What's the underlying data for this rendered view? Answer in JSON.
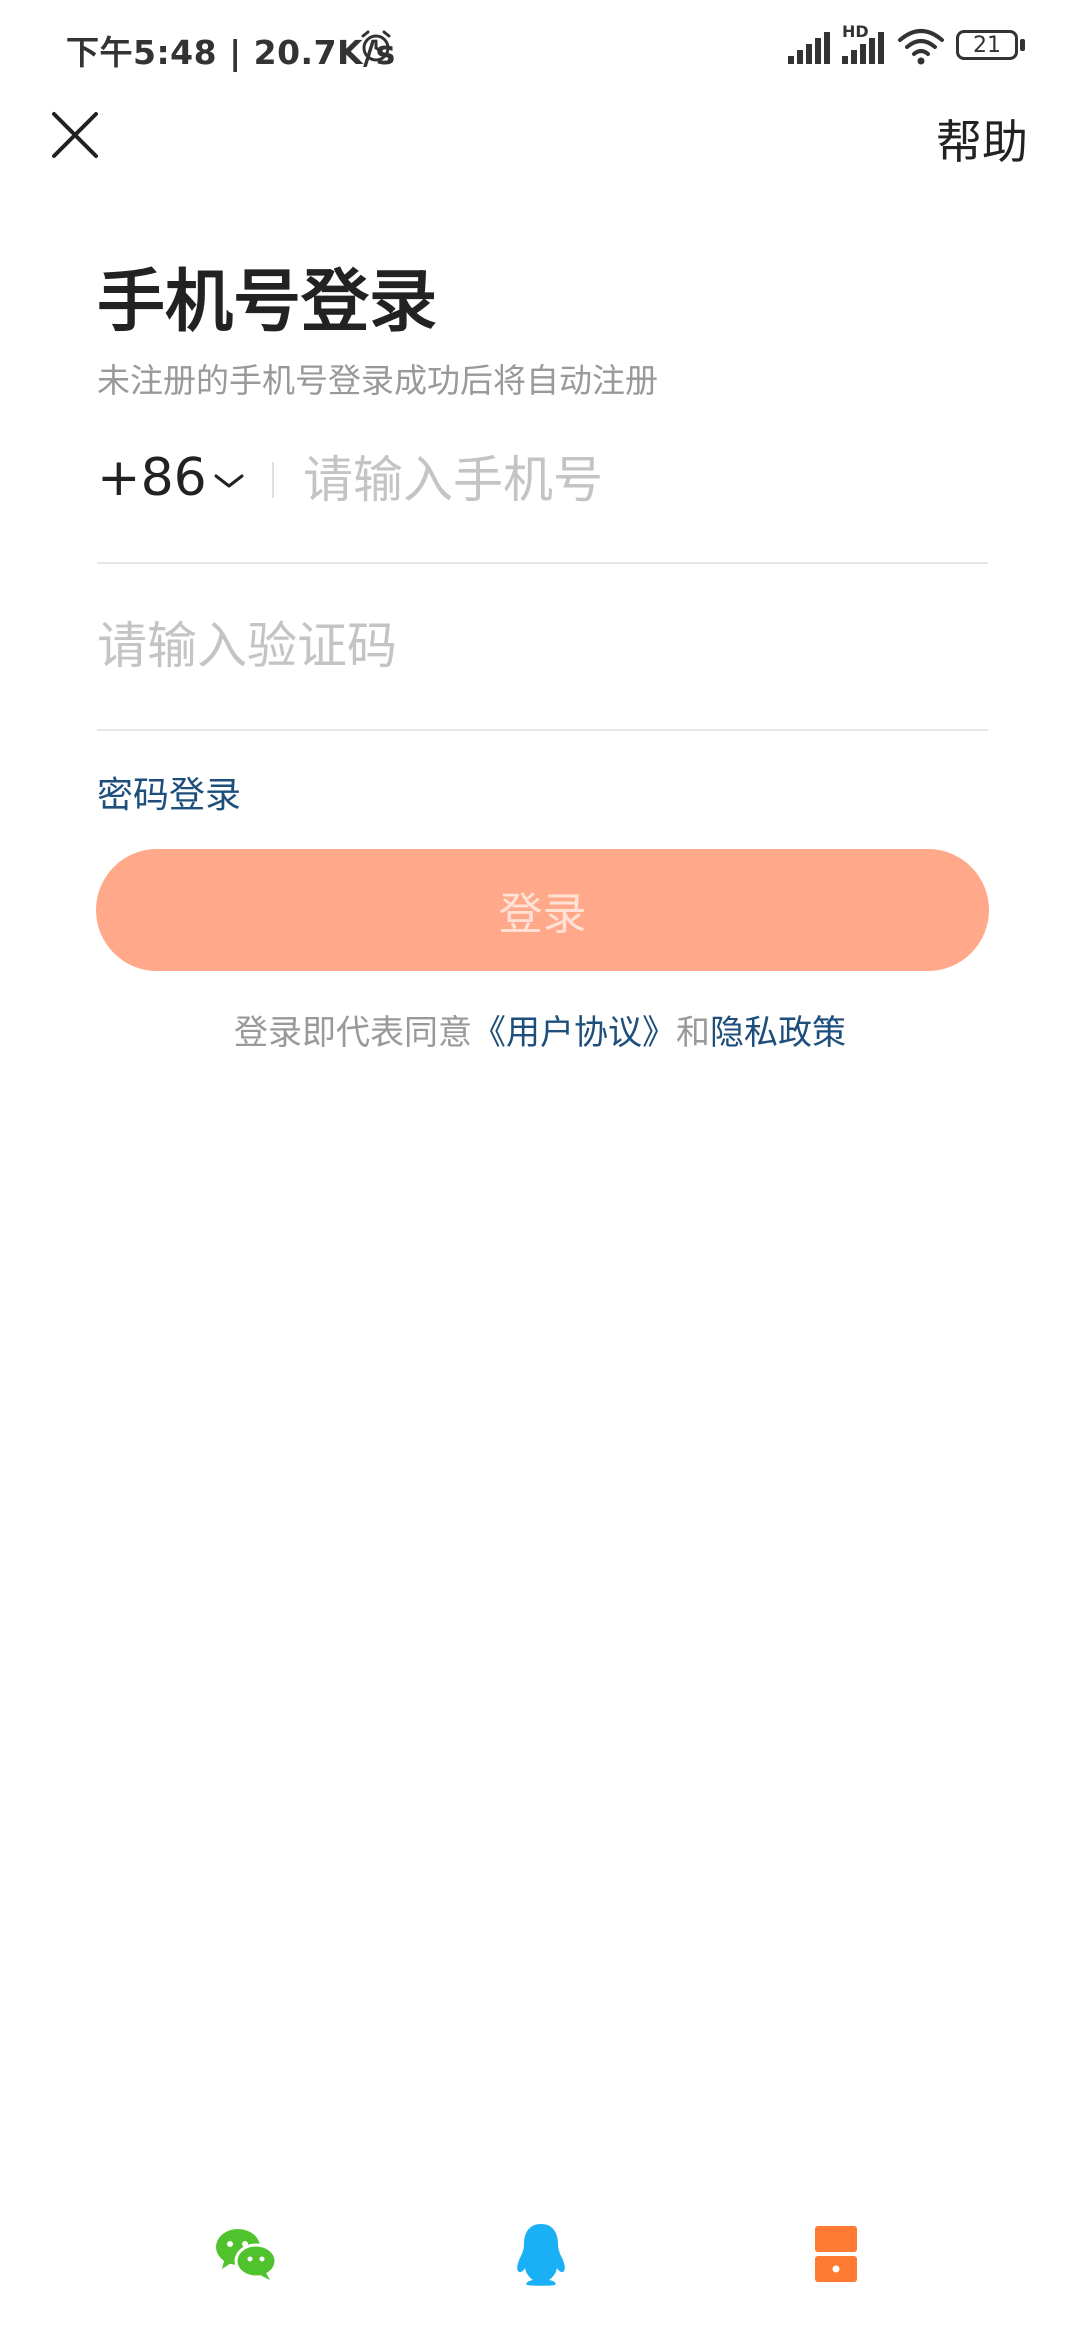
{
  "status_bar": {
    "time_speed": "下午5:48 | 20.7K/s",
    "battery": "21",
    "network_label": "HD"
  },
  "nav": {
    "help_label": "帮助"
  },
  "login": {
    "title": "手机号登录",
    "subtitle": "未注册的手机号登录成功后将自动注册",
    "country_code": "+86",
    "phone_placeholder": "请输入手机号",
    "code_placeholder": "请输入验证码",
    "password_login_label": "密码登录",
    "login_button_label": "登录"
  },
  "agreement": {
    "prefix": "登录即代表同意",
    "user_agreement": "《用户协议》",
    "conjunction": "和",
    "privacy_policy": "隐私政策"
  },
  "social": {
    "wechat_color": "#4fc22d",
    "qq_color": "#1ab0f5",
    "other_color": "#ff7a33"
  }
}
